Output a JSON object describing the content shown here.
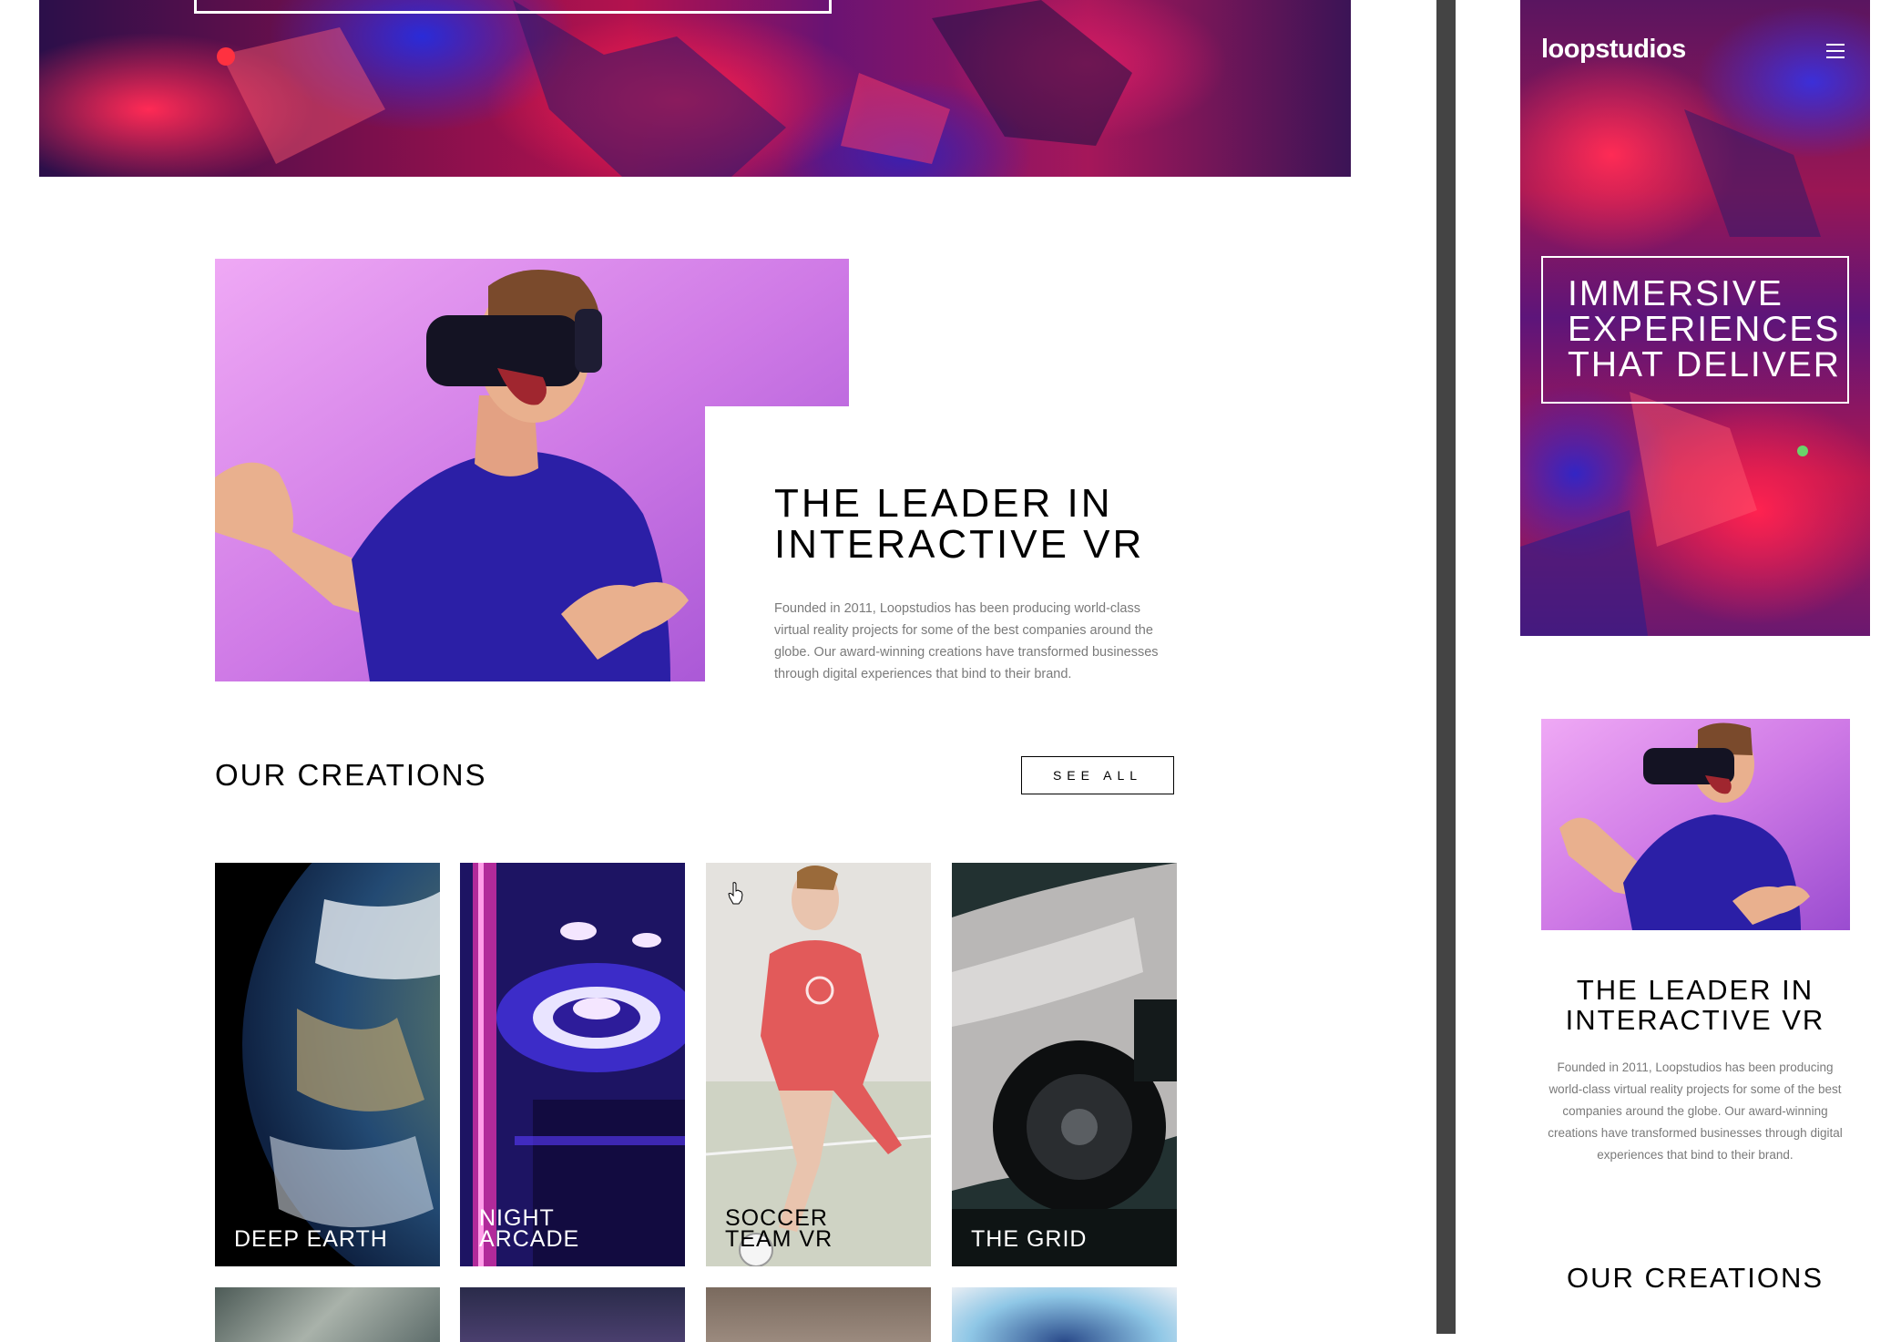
{
  "desktop": {
    "about": {
      "title_line1": "THE LEADER IN",
      "title_line2": "INTERACTIVE VR",
      "body": "Founded in 2011, Loopstudios has been producing world-class virtual reality projects for some of the best companies around the globe. Our award-winning creations have transformed businesses through digital experiences that bind to their brand."
    },
    "creations": {
      "title": "OUR CREATIONS",
      "see_all_label": "SEE ALL",
      "cards": [
        {
          "line1": "DEEP EARTH",
          "line2": ""
        },
        {
          "line1": "NIGHT",
          "line2": "ARCADE"
        },
        {
          "line1": "SOCCER",
          "line2": "TEAM VR"
        },
        {
          "line1": "THE GRID",
          "line2": ""
        }
      ]
    }
  },
  "mobile": {
    "logo": "loopstudios",
    "hero_line1": "IMMERSIVE",
    "hero_line2": "EXPERIENCES",
    "hero_line3": "THAT DELIVER",
    "about_title_line1": "THE LEADER IN",
    "about_title_line2": "INTERACTIVE VR",
    "about_body": "Founded in 2011, Loopstudios has been producing world-class virtual reality projects for some of the best companies around the globe. Our award-winning creations have transformed businesses through digital experiences that bind to their brand.",
    "creations_title": "OUR CREATIONS"
  },
  "icons": {
    "menu": "hamburger-icon",
    "cursor": "pointer-hand-icon"
  },
  "colors": {
    "divider": "#444444",
    "body_text": "#7a7a7a",
    "vr_bg": "#c86fe6",
    "shirt": "#2b1fa6"
  }
}
